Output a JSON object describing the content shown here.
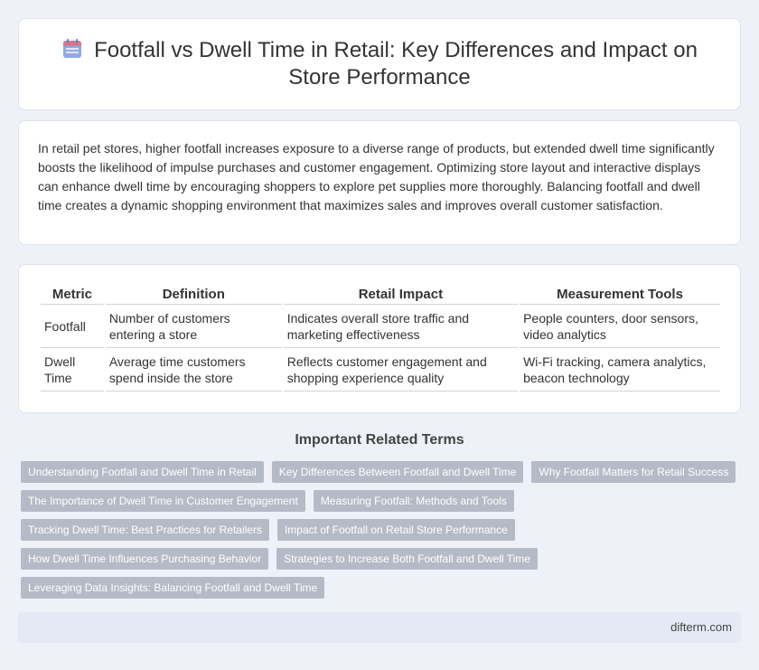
{
  "header": {
    "title": "Footfall vs Dwell Time in Retail: Key Differences and Impact on Store Performance",
    "icon": "calendar-icon"
  },
  "intro": {
    "text": "In retail pet stores, higher footfall increases exposure to a diverse range of products, but extended dwell time significantly boosts the likelihood of impulse purchases and customer engagement. Optimizing store layout and interactive displays can enhance dwell time by encouraging shoppers to explore pet supplies more thoroughly. Balancing footfall and dwell time creates a dynamic shopping environment that maximizes sales and improves overall customer satisfaction."
  },
  "table": {
    "headers": [
      "Metric",
      "Definition",
      "Retail Impact",
      "Measurement Tools"
    ],
    "rows": [
      [
        "Footfall",
        "Number of customers entering a store",
        "Indicates overall store traffic and marketing effectiveness",
        "People counters, door sensors, video analytics"
      ],
      [
        "Dwell Time",
        "Average time customers spend inside the store",
        "Reflects customer engagement and shopping experience quality",
        "Wi-Fi tracking, camera analytics, beacon technology"
      ]
    ]
  },
  "related": {
    "title": "Important Related Terms",
    "tags": [
      "Understanding Footfall and Dwell Time in Retail",
      "Key Differences Between Footfall and Dwell Time",
      "Why Footfall Matters for Retail Success",
      "The Importance of Dwell Time in Customer Engagement",
      "Measuring Footfall: Methods and Tools",
      "Tracking Dwell Time: Best Practices for Retailers",
      "Impact of Footfall on Retail Store Performance",
      "How Dwell Time Influences Purchasing Behavior",
      "Strategies to Increase Both Footfall and Dwell Time",
      "Leveraging Data Insights: Balancing Footfall and Dwell Time"
    ]
  },
  "footer": {
    "site": "difterm.com"
  }
}
